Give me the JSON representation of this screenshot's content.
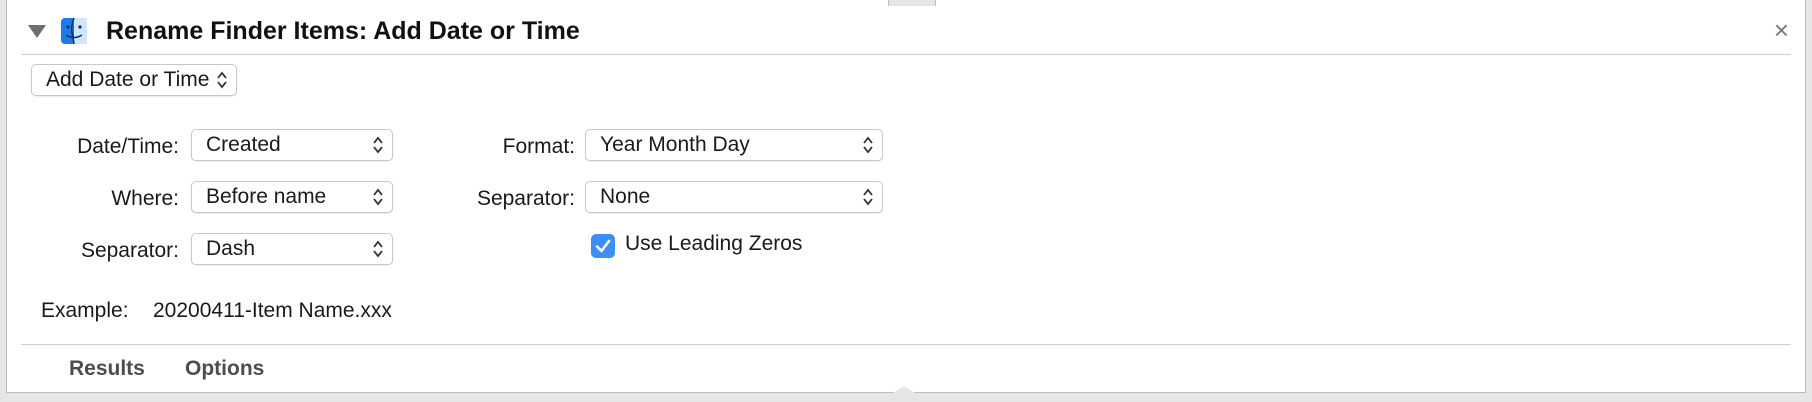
{
  "header": {
    "title": "Rename Finder Items: Add Date or Time",
    "close_glyph": "×"
  },
  "action_popup": {
    "value": "Add Date or Time"
  },
  "left_column": {
    "datetime_label": "Date/Time:",
    "datetime_value": "Created",
    "where_label": "Where:",
    "where_value": "Before name",
    "separator_label": "Separator:",
    "separator_value": "Dash"
  },
  "right_column": {
    "format_label": "Format:",
    "format_value": "Year Month Day",
    "separator_label": "Separator:",
    "separator_value": "None",
    "leading_zeros_label": "Use Leading Zeros",
    "leading_zeros_checked": true
  },
  "example": {
    "label": "Example:",
    "value": "20200411-Item Name.xxx"
  },
  "footer": {
    "results_tab": "Results",
    "options_tab": "Options"
  },
  "colors": {
    "accent": "#3b8ff5",
    "background": "#e6e6e6",
    "card": "#ffffff"
  },
  "icons": [
    "disclosure-triangle-icon",
    "finder-icon",
    "close-icon",
    "popup-chevron-icon",
    "checkmark-icon"
  ]
}
